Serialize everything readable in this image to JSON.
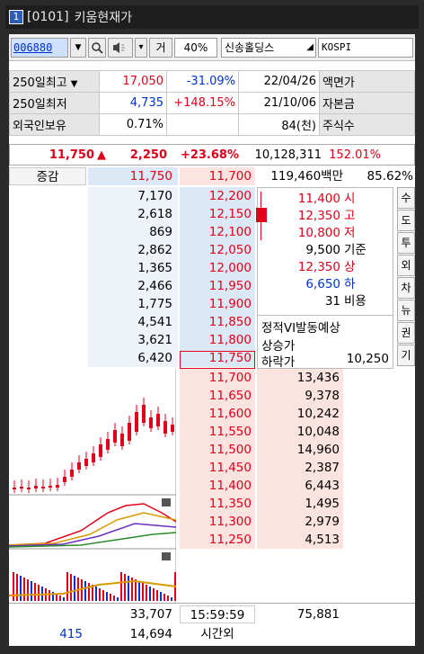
{
  "title": {
    "window_number": "1",
    "screen_code": "[0101]",
    "screen_name": "키움현재가"
  },
  "toolbar": {
    "code": "006880",
    "dropdown": "▼",
    "search": "🔍",
    "speaker": "◀",
    "gear": "▾",
    "geo_label": "거",
    "pct": "40%",
    "stock_name": "신송홀딩스",
    "market": "KOSPI"
  },
  "info": [
    {
      "label": "250일최고",
      "arrow": "▼",
      "price": "17,050",
      "rate": "-31.09%",
      "date": "22/04/26",
      "tag": "액면가"
    },
    {
      "label": "250일최저",
      "arrow": "",
      "price": "4,735",
      "rate": "+148.15%",
      "date": "21/10/06",
      "tag": "자본금"
    },
    {
      "label": "외국인보유",
      "arrow": "",
      "price": "0.71%",
      "rate": "",
      "date": "84(천)",
      "tag": "주식수"
    }
  ],
  "pricebar": {
    "price": "11,750",
    "arrow": "▲",
    "change": "2,250",
    "rate": "+23.68%",
    "volume": "10,128,311",
    "volume_rate": "152.01%"
  },
  "hdr": {
    "label": "증감",
    "ask": "11,750",
    "bid": "11,700",
    "amount": "119,460백만",
    "ratio": "85.62%"
  },
  "asks": [
    {
      "vol": "7,170",
      "price": "12,200"
    },
    {
      "vol": "2,618",
      "price": "12,150"
    },
    {
      "vol": "869",
      "price": "12,100"
    },
    {
      "vol": "2,862",
      "price": "12,050"
    },
    {
      "vol": "1,365",
      "price": "12,000"
    },
    {
      "vol": "2,466",
      "price": "11,950"
    },
    {
      "vol": "1,775",
      "price": "11,900"
    },
    {
      "vol": "4,541",
      "price": "11,850"
    },
    {
      "vol": "3,621",
      "price": "11,800"
    },
    {
      "vol": "6,420",
      "price": "11,750"
    }
  ],
  "quote": [
    {
      "value": "11,400",
      "label": "시"
    },
    {
      "value": "12,350",
      "label": "고"
    },
    {
      "value": "10,800",
      "label": "저"
    },
    {
      "value": "9,500",
      "label": "기준"
    },
    {
      "value": "12,350",
      "label": "상"
    },
    {
      "value": "6,650",
      "label": "하"
    },
    {
      "value": "31",
      "label": "비용"
    }
  ],
  "vi": {
    "title": "정적VI발동예상",
    "up": "상승가",
    "down": "하락가",
    "down_value": "10,250"
  },
  "side_buttons": [
    "수",
    "도",
    "투",
    "외",
    "차",
    "뉴",
    "권",
    "기"
  ],
  "bids": [
    {
      "price": "11,700",
      "vol": "13,436"
    },
    {
      "price": "11,650",
      "vol": "9,378"
    },
    {
      "price": "11,600",
      "vol": "10,242"
    },
    {
      "price": "11,550",
      "vol": "10,048"
    },
    {
      "price": "11,500",
      "vol": "14,960"
    },
    {
      "price": "11,450",
      "vol": "2,387"
    },
    {
      "price": "11,400",
      "vol": "6,443"
    },
    {
      "price": "11,350",
      "vol": "1,495"
    },
    {
      "price": "11,300",
      "vol": "2,979"
    },
    {
      "price": "11,250",
      "vol": "4,513"
    }
  ],
  "footer": {
    "ask_total": "33,707",
    "time": "15:59:59",
    "bid_total": "75,881",
    "left_count": "415",
    "after_vol": "14,694",
    "after_label": "시간외"
  },
  "colors": {
    "red": "#e0001a",
    "blue": "#0033d6",
    "ask_bg": "#dce8f6",
    "bid_bg": "#fbe3e0"
  }
}
